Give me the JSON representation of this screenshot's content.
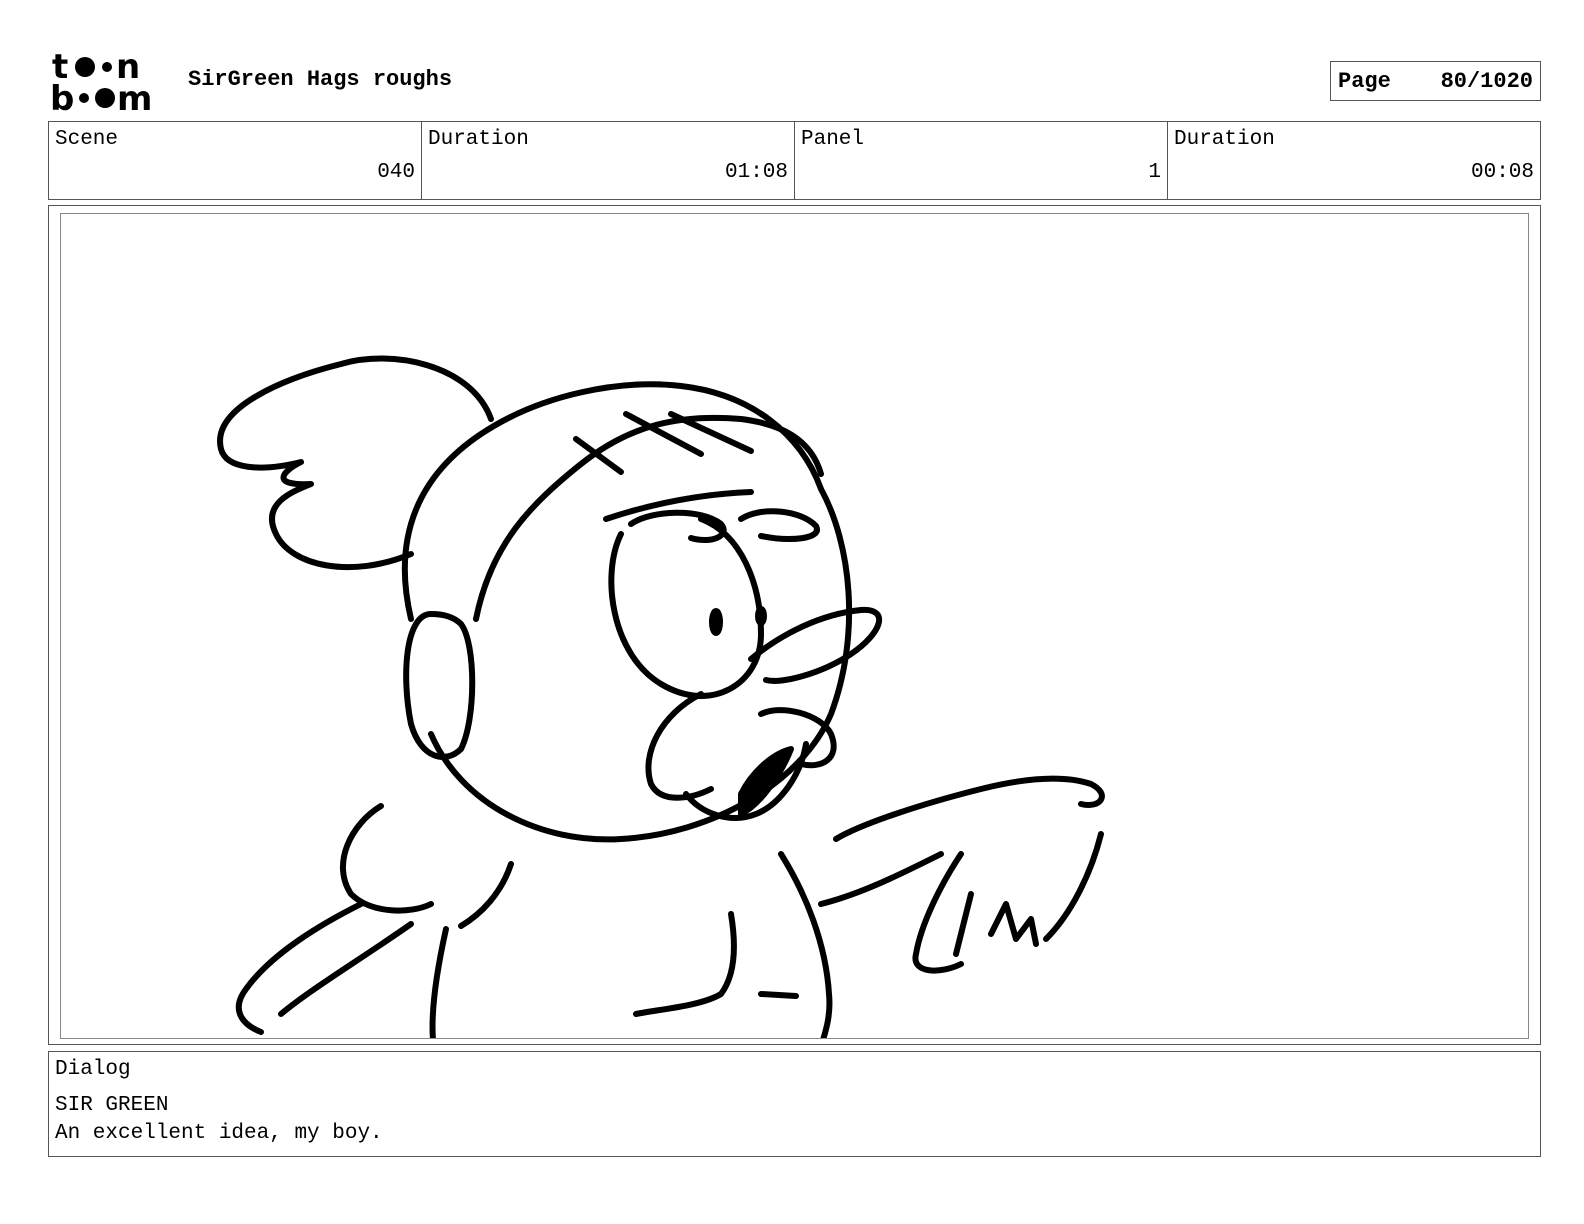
{
  "header": {
    "logo": {
      "icon": "toonboom-logo",
      "line1": "toon",
      "line2": "boom"
    },
    "project_title": "SirGreen Hags roughs",
    "page_label": "Page",
    "page_value": "80/1020"
  },
  "info": {
    "scene_label": "Scene",
    "scene_value": "040",
    "scene_duration_label": "Duration",
    "scene_duration_value": "01:08",
    "panel_label": "Panel",
    "panel_value": "1",
    "panel_duration_label": "Duration",
    "panel_duration_value": "00:08"
  },
  "panel_image": {
    "icon": "storyboard-sketch-sir-green"
  },
  "dialog": {
    "label": "Dialog",
    "character": "SIR GREEN",
    "line": "An excellent idea, my boy."
  }
}
